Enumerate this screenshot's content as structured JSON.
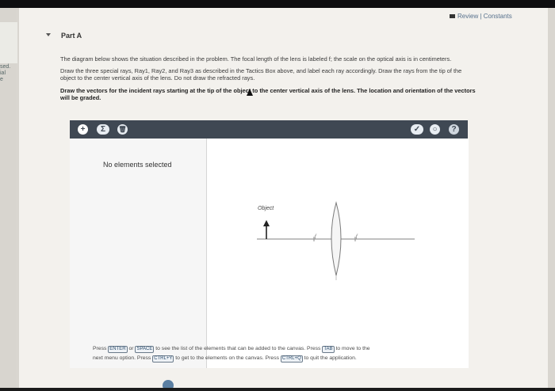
{
  "header": {
    "review_link": "Review | Constants"
  },
  "sidebar": {
    "line1": "sed.",
    "line2": "ial",
    "line3": "e"
  },
  "part": {
    "title": "Part A"
  },
  "instructions": {
    "para1": "The diagram below shows the situation described in the problem. The focal length of the lens is labeled f; the scale on the optical axis is in centimeters.",
    "para2_line1": "Draw the three special rays, Ray1, Ray2, and Ray3 as described in the Tactics Box above, and label each ray accordingly. Draw the rays from the tip of the",
    "para2_line2": "object to the center vertical axis of the lens. Do not draw the refracted rays.",
    "para3_line1": "Draw the vectors for the incident rays starting at the tip of the object to the center vertical axis of the lens. The location and orientation of the vectors",
    "para3_line2": "will be graded."
  },
  "toolbar": {
    "plus": "+",
    "sigma": "Σ",
    "trash": "🗑",
    "right1": "✓",
    "right2": "○",
    "help": "?"
  },
  "canvas": {
    "side_panel_text": "No elements selected",
    "object_label": "Object",
    "focal_label": "f"
  },
  "help": {
    "press": "Press",
    "key_enter": "ENTER",
    "or": "or",
    "key_space": "SPACE",
    "text1": "to see the list of the elements that can be added to the canvas. Press",
    "key_tab": "TAB",
    "text2": "to move to the",
    "text3": "next menu option. Press",
    "key_ctrl_y": "CTRL+Y",
    "text4": "to get to the elements on the canvas. Press",
    "key_ctrl_q": "CTRL+Q",
    "text5": "to quit the application."
  },
  "colors": {
    "toolbar": "#3f4853",
    "link": "#56708c"
  }
}
